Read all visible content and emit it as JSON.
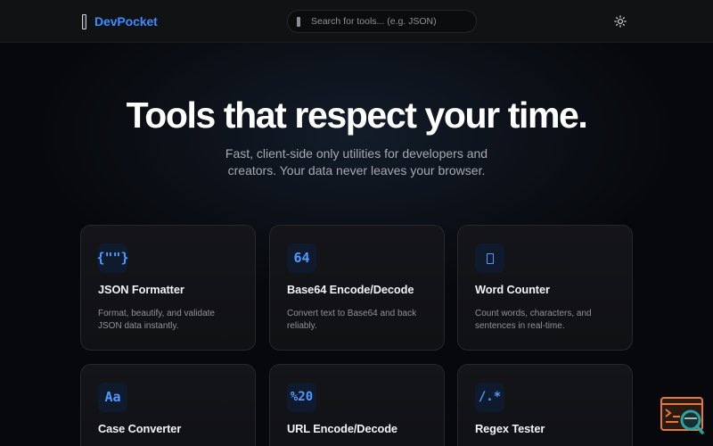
{
  "header": {
    "brand_name": "DevPocket",
    "search_placeholder": "Search for tools... (e.g. JSON)",
    "theme_icon": "sun-icon"
  },
  "hero": {
    "title": "Tools that respect your time.",
    "subtitle": "Fast, client-side only utilities for developers and creators. Your data never leaves your browser."
  },
  "colors": {
    "accent": "#3b8cff",
    "background": "#07080b",
    "card": "#141518",
    "fab_orange": "#e27a3f",
    "fab_teal": "#2aa3a0"
  },
  "tools": [
    {
      "icon_text": "{\"\"}",
      "title": "JSON Formatter",
      "description": "Format, beautify, and validate JSON data instantly."
    },
    {
      "icon_text": "64",
      "title": "Base64 Encode/Decode",
      "description": "Convert text to Base64 and back reliably."
    },
    {
      "icon_text": "",
      "icon_name": "document-icon",
      "title": "Word Counter",
      "description": "Count words, characters, and sentences in real-time."
    },
    {
      "icon_text": "Aa",
      "title": "Case Converter",
      "description": ""
    },
    {
      "icon_text": "%20",
      "title": "URL Encode/Decode",
      "description": ""
    },
    {
      "icon_text": "/.*",
      "title": "Regex Tester",
      "description": ""
    }
  ],
  "floating_action": {
    "icon_name": "terminal-search-icon"
  }
}
